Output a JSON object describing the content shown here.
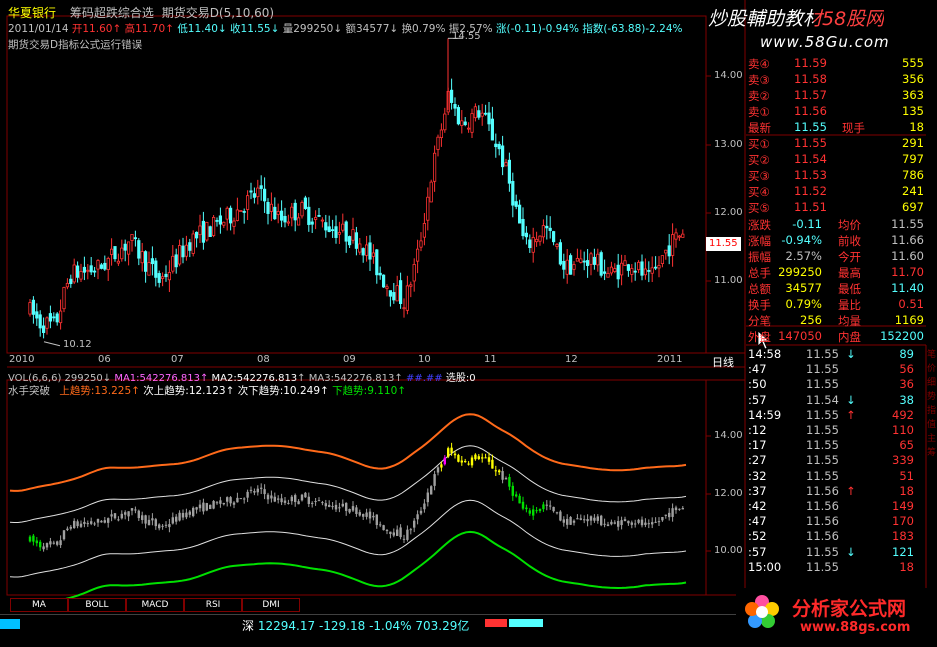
{
  "colors": {
    "up": "#ff3232",
    "down": "#54ffff",
    "frame": "#800000",
    "yellow": "#ffff00",
    "green": "#00c000",
    "orange": "#ff6a1a",
    "magenta": "#ff00ff",
    "white": "#ffffff"
  },
  "header": {
    "stock_name": "华夏银行",
    "formula1": "筹码超跌综合选",
    "formula2": "期货交易D(5,10,60)",
    "date": "2011/01/14",
    "open": "开11.60",
    "high": "高11.70",
    "low": "低11.40",
    "close": "收11.55",
    "volume": "量299250",
    "amount": "额34577",
    "turnover": "换0.79%",
    "amplitude": "振2.57%",
    "change": "涨(-0.11)-0.94%",
    "index": "指数(-63.88)-2.24%",
    "error_msg": "期货交易D指标公式运行错误"
  },
  "watermarks": {
    "top_title": "炒股輔助教材58股网",
    "top_url": "www.58Gu.com",
    "bottom_title": "分析家公式网",
    "bottom_url": "www.88gs.com"
  },
  "price_chart": {
    "high_label": "14.55",
    "low_label": "10.12",
    "current_price_tag": "11.55",
    "y_labels": [
      "14.00",
      "13.00",
      "12.00",
      "11.00"
    ],
    "period_label": "日线",
    "months": [
      "2010",
      "06",
      "07",
      "08",
      "09",
      "10",
      "11",
      "12",
      "2011"
    ]
  },
  "vol_line": {
    "label": "VOL(6,6,6)",
    "vol": "299250",
    "ma1": "MA1:542276.813",
    "ma2": "MA2:542276.813",
    "ma3": "MA3:542276.813",
    "pick_a": "##.##",
    "pick_b": "选股:0"
  },
  "indicator": {
    "name": "水手突破",
    "up": "上趋势:13.225",
    "sub_up": "次上趋势:12.123",
    "sub_down": "次下趋势:10.249",
    "down": "下趋势:9.110",
    "y_labels": [
      "14.00",
      "12.00",
      "10.00"
    ]
  },
  "tabs": [
    "MA",
    "BOLL",
    "MACD",
    "RSI",
    "DMI"
  ],
  "status_bar": {
    "market": "深",
    "index_value": "12294.17",
    "change": "-129.18",
    "pct": "-1.04%",
    "amount": "703.29亿"
  },
  "order_book": {
    "asks": [
      {
        "label": "卖④",
        "price": "11.59",
        "vol": "555"
      },
      {
        "label": "卖③",
        "price": "11.58",
        "vol": "356"
      },
      {
        "label": "卖②",
        "price": "11.57",
        "vol": "363"
      },
      {
        "label": "卖①",
        "price": "11.56",
        "vol": "135"
      }
    ],
    "latest": {
      "label": "最新",
      "price": "11.55",
      "vol_label": "现手",
      "vol": "18"
    },
    "bids": [
      {
        "label": "买①",
        "price": "11.55",
        "vol": "291"
      },
      {
        "label": "买②",
        "price": "11.54",
        "vol": "797"
      },
      {
        "label": "买③",
        "price": "11.53",
        "vol": "786"
      },
      {
        "label": "买④",
        "price": "11.52",
        "vol": "241"
      },
      {
        "label": "买⑤",
        "price": "11.51",
        "vol": "697"
      }
    ]
  },
  "stats": [
    {
      "l1": "涨跌",
      "v1": "-0.11",
      "l2": "均价",
      "v2": "11.55"
    },
    {
      "l1": "涨幅",
      "v1": "-0.94%",
      "l2": "前收",
      "v2": "11.66"
    },
    {
      "l1": "振幅",
      "v1": "2.57%",
      "l2": "今开",
      "v2": "11.60"
    },
    {
      "l1": "总手",
      "v1": "299250",
      "l2": "最高",
      "v2": "11.70"
    },
    {
      "l1": "总额",
      "v1": "34577",
      "l2": "最低",
      "v2": "11.40"
    },
    {
      "l1": "换手",
      "v1": "0.79%",
      "l2": "量比",
      "v2": "0.51"
    },
    {
      "l1": "分笔",
      "v1": "256",
      "l2": "均量",
      "v2": "1169"
    }
  ],
  "outer_inner": {
    "outer_label": "外盘",
    "outer": "147050",
    "inner_label": "内盘",
    "inner": "152200"
  },
  "ticks": [
    {
      "time": "14:58",
      "price": "11.55",
      "arrow": "↓",
      "vol": "89"
    },
    {
      "time": ":47",
      "price": "11.55",
      "arrow": "",
      "vol": "56"
    },
    {
      "time": ":50",
      "price": "11.55",
      "arrow": "",
      "vol": "36"
    },
    {
      "time": ":57",
      "price": "11.54",
      "arrow": "↓",
      "vol": "38"
    },
    {
      "time": "14:59",
      "price": "11.55",
      "arrow": "↑",
      "vol": "492"
    },
    {
      "time": ":12",
      "price": "11.55",
      "arrow": "",
      "vol": "110"
    },
    {
      "time": ":17",
      "price": "11.55",
      "arrow": "",
      "vol": "65"
    },
    {
      "time": ":27",
      "price": "11.55",
      "arrow": "",
      "vol": "339"
    },
    {
      "time": ":32",
      "price": "11.55",
      "arrow": "",
      "vol": "51"
    },
    {
      "time": ":37",
      "price": "11.56",
      "arrow": "↑",
      "vol": "18"
    },
    {
      "time": ":42",
      "price": "11.56",
      "arrow": "",
      "vol": "149"
    },
    {
      "time": ":47",
      "price": "11.56",
      "arrow": "",
      "vol": "170"
    },
    {
      "time": ":52",
      "price": "11.56",
      "arrow": "",
      "vol": "183"
    },
    {
      "time": ":57",
      "price": "11.55",
      "arrow": "↓",
      "vol": "121"
    },
    {
      "time": "15:00",
      "price": "11.55",
      "arrow": "",
      "vol": "18"
    }
  ],
  "right_side_tabs": [
    "笔",
    "价",
    "细",
    "势",
    "指",
    "值",
    "主",
    "筹"
  ]
}
